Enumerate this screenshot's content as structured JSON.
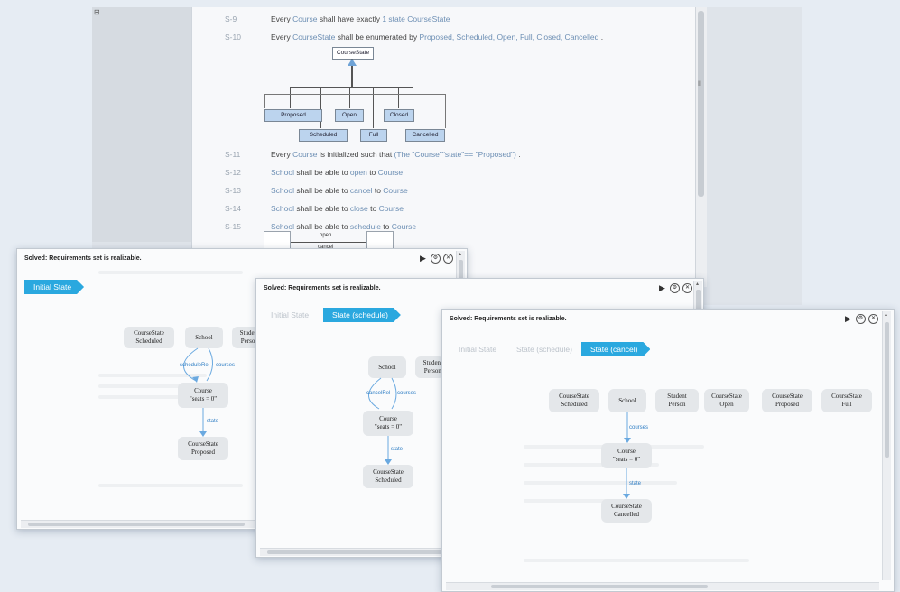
{
  "doc": {
    "requirements": [
      {
        "num": "S-9",
        "text": [
          {
            "t": "Every "
          },
          {
            "t": "Course",
            "k": 1
          },
          {
            "t": " shall have exactly "
          },
          {
            "t": "1 state CourseState",
            "k": 1
          }
        ]
      },
      {
        "num": "S-10",
        "text": [
          {
            "t": "Every "
          },
          {
            "t": "CourseState",
            "k": 1
          },
          {
            "t": " shall be enumerated by "
          },
          {
            "t": "Proposed, Scheduled, Open, Full, Closed, Cancelled",
            "k": 1
          },
          {
            "t": " ."
          }
        ]
      },
      {
        "num": "S-11",
        "text": [
          {
            "t": "Every "
          },
          {
            "t": "Course",
            "k": 1
          },
          {
            "t": " is initialized such that "
          },
          {
            "t": "(The \"Course\"\"state\"== \"Proposed\")",
            "k": 1
          },
          {
            "t": " ."
          }
        ]
      },
      {
        "num": "S-12",
        "text": [
          {
            "t": "School",
            "k": 1
          },
          {
            "t": " shall be able to "
          },
          {
            "t": "open",
            "k": 1
          },
          {
            "t": " to "
          },
          {
            "t": "Course",
            "k": 1
          }
        ]
      },
      {
        "num": "S-13",
        "text": [
          {
            "t": "School",
            "k": 1
          },
          {
            "t": " shall be able to "
          },
          {
            "t": "cancel",
            "k": 1
          },
          {
            "t": " to "
          },
          {
            "t": "Course",
            "k": 1
          }
        ]
      },
      {
        "num": "S-14",
        "text": [
          {
            "t": "School",
            "k": 1
          },
          {
            "t": " shall be able to "
          },
          {
            "t": "close",
            "k": 1
          },
          {
            "t": " to "
          },
          {
            "t": "Course",
            "k": 1
          }
        ]
      },
      {
        "num": "S-15",
        "text": [
          {
            "t": "School",
            "k": 1
          },
          {
            "t": " shall be able to "
          },
          {
            "t": "schedule",
            "k": 1
          },
          {
            "t": " to "
          },
          {
            "t": "Course",
            "k": 1
          }
        ]
      }
    ],
    "uml": {
      "parent": "CourseState",
      "subtypes": [
        "Proposed",
        "Open",
        "Closed",
        "Scheduled",
        "Full",
        "Cancelled"
      ]
    },
    "state_strip": {
      "top_label": "open",
      "bottom_label": "cancel"
    }
  },
  "windows": [
    {
      "status": "Solved: Requirements set is realizable.",
      "crumbs": [
        {
          "label": "Initial State",
          "active": true
        }
      ],
      "nodes": [
        "CourseState\nScheduled",
        "School",
        "Student\nPerson",
        "Course\n\"seats = 0\"",
        "CourseState\nProposed"
      ],
      "edge_labels": [
        "scheduleRel",
        "courses",
        "state"
      ]
    },
    {
      "status": "Solved: Requirements set is realizable.",
      "crumbs": [
        {
          "label": "Initial State",
          "active": false
        },
        {
          "label": "State (schedule)",
          "active": true
        }
      ],
      "nodes": [
        "School",
        "Student\nPerson",
        "Course\n\"seats = 0\"",
        "CourseState\nScheduled"
      ],
      "edge_labels": [
        "cancelRel",
        "courses",
        "state"
      ]
    },
    {
      "status": "Solved: Requirements set is realizable.",
      "crumbs": [
        {
          "label": "Initial State",
          "active": false
        },
        {
          "label": "State (schedule)",
          "active": false
        },
        {
          "label": "State (cancel)",
          "active": true
        }
      ],
      "nodes": [
        "CourseState\nScheduled",
        "School",
        "Student\nPerson",
        "CourseState\nOpen",
        "CourseState\nProposed",
        "CourseState\nFull",
        "Course\n\"seats = 0\"",
        "CourseState\nCancelled"
      ],
      "edge_labels": [
        "courses",
        "state"
      ]
    }
  ],
  "controls": {
    "play": "▶",
    "settings": "⚙",
    "close": "✕"
  },
  "icons": {
    "play": "play-icon",
    "settings": "settings-icon",
    "close": "close-icon"
  },
  "colors": {
    "accent": "#2aa8df",
    "keyword": "#6d8fb4",
    "edge": "#2d7dc4",
    "uml_subtype": "#bcd4ee"
  }
}
